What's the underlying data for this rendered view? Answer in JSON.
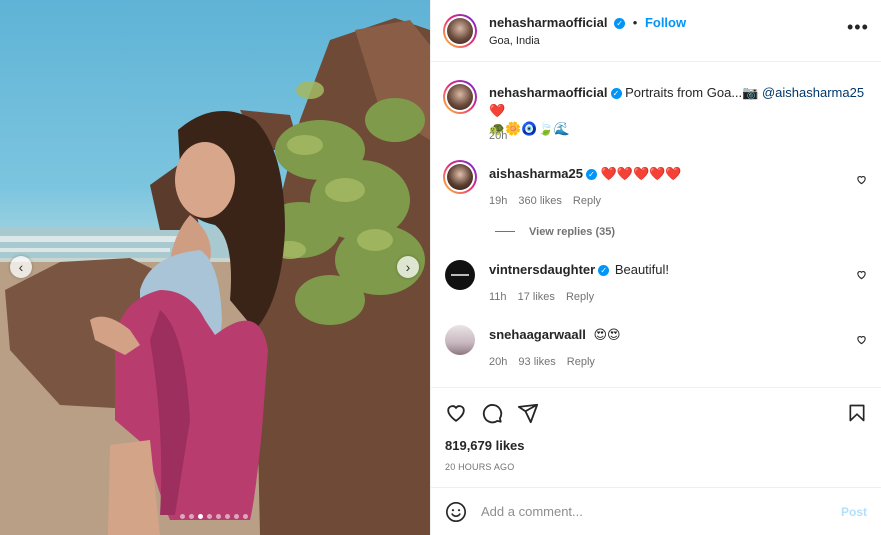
{
  "post": {
    "author": "nehasharmaofficial",
    "follow_label": "Follow",
    "separator": "•",
    "location": "Goa, India",
    "more_label": "•••",
    "media": {
      "prev_label": "‹",
      "next_label": "›",
      "slide_count": 8,
      "active_slide": 2
    }
  },
  "caption": {
    "author": "nehasharmaofficial",
    "text": "Portraits from Goa...📷",
    "mention": "@aishasharma25",
    "mention_emoji": "❤️",
    "emoji_line": "🐢🌼🧿🍃🌊",
    "time": "20h"
  },
  "comments": [
    {
      "author": "aishasharma25",
      "verified": true,
      "text": "❤️❤️❤️❤️❤️",
      "time": "19h",
      "likes": "360 likes",
      "reply_label": "Reply",
      "view_replies": "View replies (35)"
    },
    {
      "author": "vintnersdaughter",
      "verified": true,
      "text": "Beautiful!",
      "time": "11h",
      "likes": "17 likes",
      "reply_label": "Reply"
    },
    {
      "author": "snehaagarwaall",
      "verified": false,
      "text": "😍😍",
      "time": "20h",
      "likes": "93 likes",
      "reply_label": "Reply"
    }
  ],
  "actions": {
    "icons": [
      "heart-icon",
      "comment-icon",
      "share-icon",
      "bookmark-icon"
    ],
    "likes": "819,679 likes",
    "time_ago": "20 HOURS AGO"
  },
  "composer": {
    "placeholder": "Add a comment...",
    "post_label": "Post"
  },
  "colors": {
    "accent": "#0095f6",
    "post_disabled": "#b2dffc",
    "text": "#262626",
    "muted": "#737373"
  }
}
